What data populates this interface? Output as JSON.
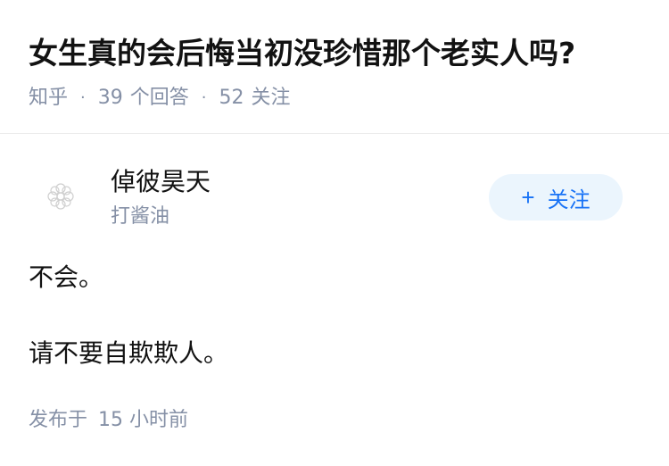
{
  "question": {
    "title": "女生真的会后悔当初没珍惜那个老实人吗?",
    "source": "知乎",
    "answers_count": "39",
    "answers_label": "个回答",
    "followers_count": "52",
    "followers_label": "关注",
    "separator": "·"
  },
  "answer": {
    "author_name": "倬彼昊天",
    "author_headline": "打酱油",
    "avatar_icon": "flower-logo-icon",
    "follow_button": {
      "icon": "+",
      "label": "关注"
    },
    "paragraphs": [
      "不会。",
      "请不要自欺欺人。"
    ],
    "published_label": "发布于",
    "published_time": "15 小时前"
  },
  "colors": {
    "accent": "#1772f6",
    "follow_bg": "#ebf5fd",
    "meta_text": "#8590a6",
    "body_text": "#121212"
  }
}
